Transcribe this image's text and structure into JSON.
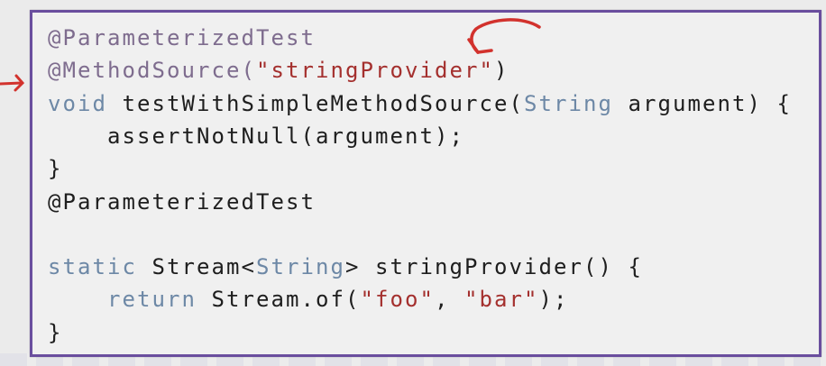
{
  "code": {
    "lines": [
      [
        {
          "t": "@ParameterizedTest",
          "c": "ann"
        }
      ],
      [
        {
          "t": "@MethodSource(",
          "c": "ann"
        },
        {
          "t": "\"stringProvider\"",
          "c": "str"
        },
        {
          "t": ")",
          "c": ""
        }
      ],
      [
        {
          "t": "void",
          "c": "kw"
        },
        {
          "t": " testWithSimpleMethodSource(",
          "c": ""
        },
        {
          "t": "String",
          "c": "ty"
        },
        {
          "t": " argument) {",
          "c": ""
        }
      ],
      [
        {
          "t": "    assertNotNull(argument);",
          "c": ""
        }
      ],
      [
        {
          "t": "}",
          "c": ""
        }
      ],
      [
        {
          "t": "@ParameterizedTest",
          "c": ""
        }
      ],
      [],
      [
        {
          "t": "static",
          "c": "kw"
        },
        {
          "t": " Stream<",
          "c": ""
        },
        {
          "t": "String",
          "c": "ty"
        },
        {
          "t": "> stringProvider() {",
          "c": ""
        }
      ],
      [
        {
          "t": "    ",
          "c": ""
        },
        {
          "t": "return",
          "c": "kw"
        },
        {
          "t": " Stream.of(",
          "c": ""
        },
        {
          "t": "\"foo\"",
          "c": "str"
        },
        {
          "t": ", ",
          "c": ""
        },
        {
          "t": "\"bar\"",
          "c": "str"
        },
        {
          "t": ");",
          "c": ""
        }
      ],
      [
        {
          "t": "}",
          "c": ""
        }
      ]
    ]
  },
  "colors": {
    "border": "#6a4e9e",
    "annotation": "#7e6c8e",
    "keyword": "#6d88a6",
    "string": "#a4302e",
    "pen": "#d2322d"
  },
  "icons": [
    "hand-drawn-arrow-left",
    "hand-drawn-arrow-curved"
  ]
}
